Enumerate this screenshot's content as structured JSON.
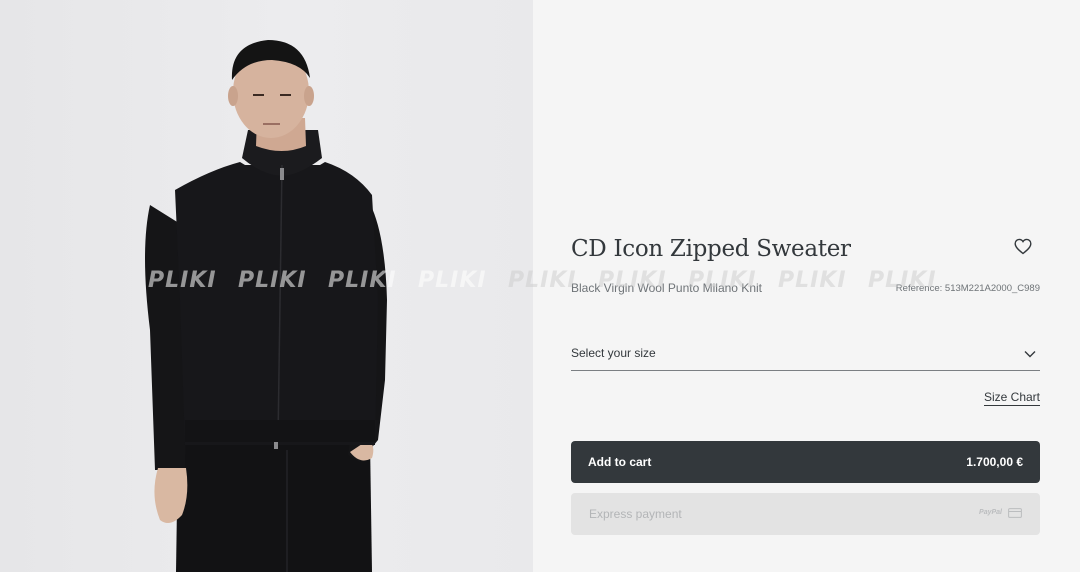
{
  "product": {
    "title": "CD Icon Zipped Sweater",
    "subtitle": "Black Virgin Wool Punto Milano Knit",
    "reference": "Reference: 513M221A2000_C989",
    "image_alt": "Model wearing black zipped sweater"
  },
  "size": {
    "placeholder": "Select your size",
    "size_chart_label": "Size Chart"
  },
  "cart": {
    "add_label": "Add to cart",
    "price": "1.700,00 €"
  },
  "express": {
    "label": "Express payment",
    "provider": "PayPal"
  },
  "watermark": {
    "text": "PLIKI"
  },
  "icons": {
    "wishlist": "heart-icon",
    "dropdown": "chevron-down-icon",
    "card": "credit-card-icon"
  }
}
